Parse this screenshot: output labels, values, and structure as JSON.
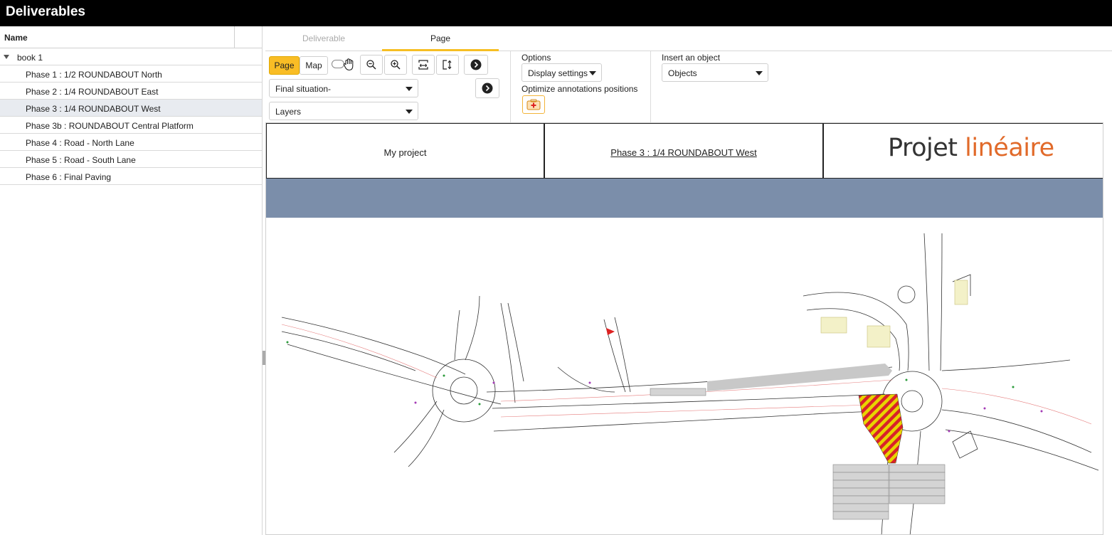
{
  "app": {
    "title": "Deliverables"
  },
  "tree": {
    "header": "Name",
    "book": "book 1",
    "phases": [
      "Phase 1 : 1/2 ROUNDABOUT North",
      "Phase 2 : 1/4 ROUNDABOUT East",
      "Phase 3 : 1/4 ROUNDABOUT West",
      "Phase 3b : ROUNDABOUT Central Platform",
      "Phase 4 : Road - North Lane",
      "Phase 5 : Road - South Lane",
      "Phase 6 : Final Paving"
    ],
    "selected_index": 2
  },
  "tabs": {
    "deliverable": "Deliverable",
    "page": "Page",
    "active": "Page"
  },
  "toolbar": {
    "page_label": "Page",
    "map_label": "Map",
    "situation_value": "Final situation-",
    "layers_value": "Layers"
  },
  "options": {
    "label": "Options",
    "display_settings": "Display settings",
    "optimize_label": "Optimize annotations positions"
  },
  "insert": {
    "label": "Insert an object",
    "objects_value": "Objects"
  },
  "page_header": {
    "project": "My project",
    "phase": "Phase 3 : 1/4 ROUNDABOUT West",
    "logo_part1": "Projet",
    "logo_part2": "linéaire"
  },
  "colors": {
    "accent": "#f9bd25",
    "band": "#7b8eaa",
    "logo_orange": "#e16a2a"
  },
  "icons": [
    "pan-hand-icon",
    "zoom-out-icon",
    "zoom-in-icon",
    "fit-width-icon",
    "fit-page-icon",
    "next-arrow-icon",
    "add-annotation-icon"
  ]
}
